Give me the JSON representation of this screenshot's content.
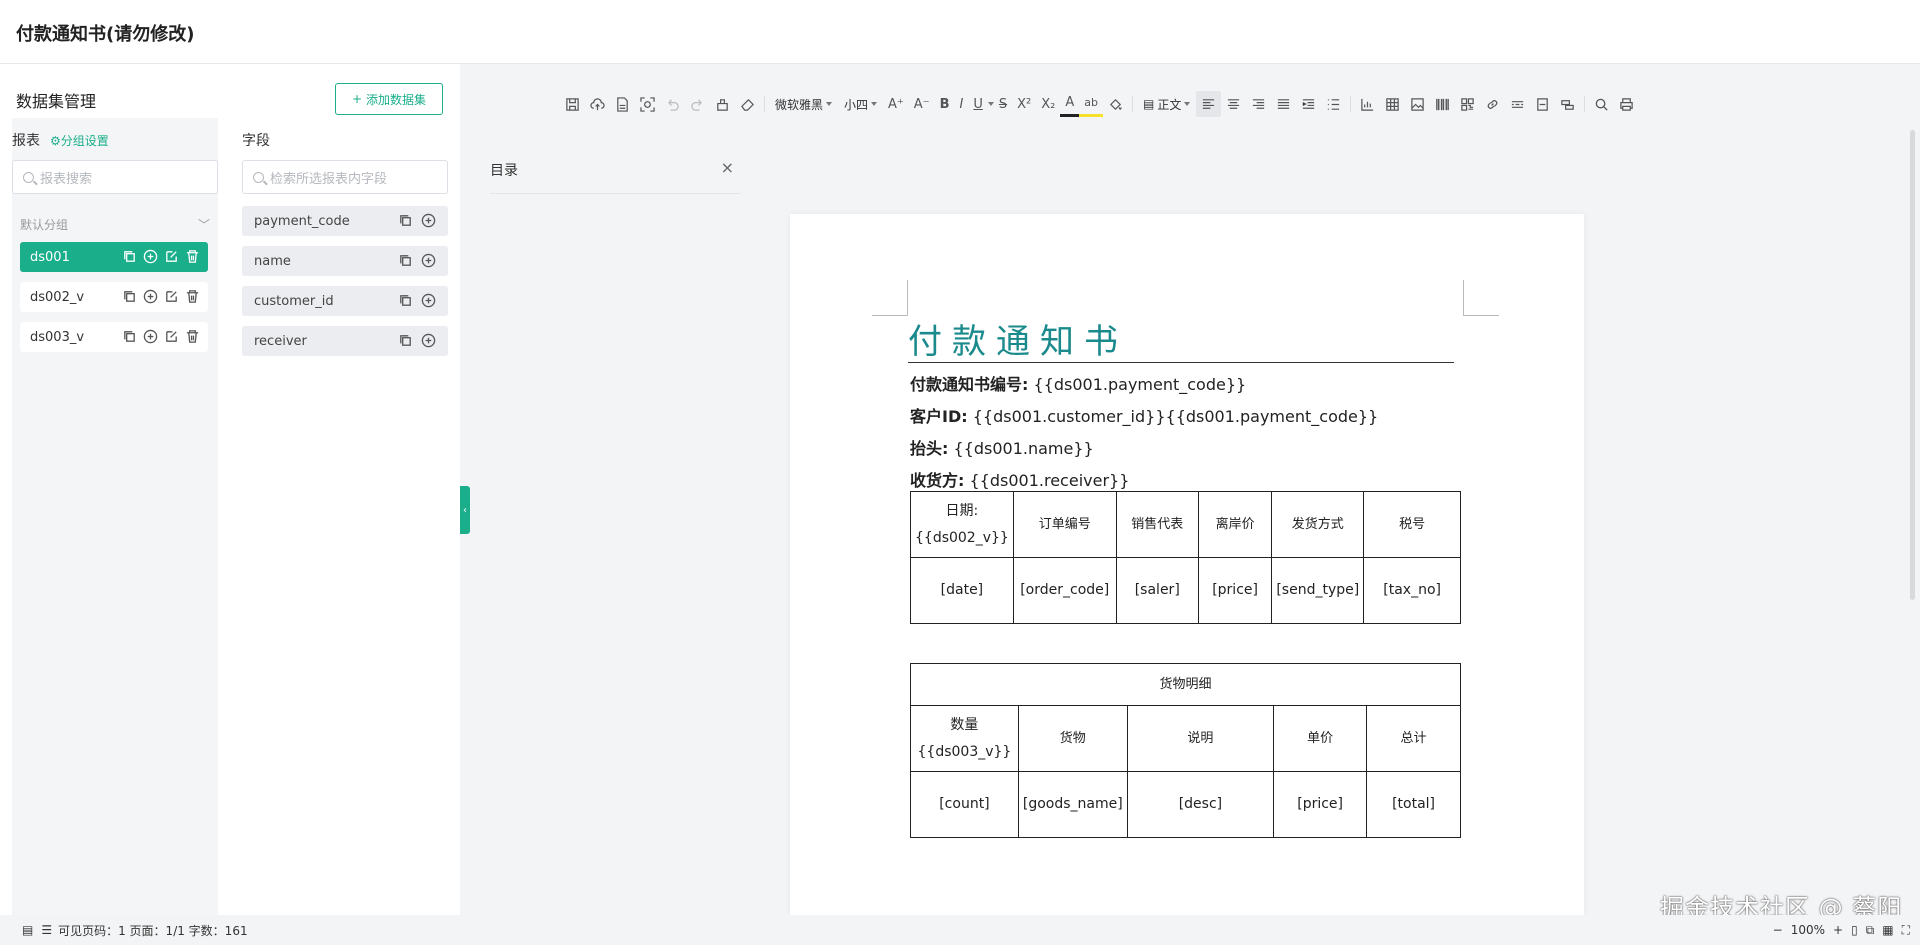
{
  "app": {
    "title": "付款通知书(请勿修改)"
  },
  "left_panel": {
    "title": "数据集管理",
    "add_button": "添加数据集",
    "reports_label": "报表",
    "group_settings": "分组设置",
    "report_search_placeholder": "报表搜索",
    "group_name": "默认分组",
    "datasets": [
      {
        "name": "ds001",
        "active": true
      },
      {
        "name": "ds002_v",
        "active": false
      },
      {
        "name": "ds003_v",
        "active": false
      }
    ],
    "fields_label": "字段",
    "field_search_placeholder": "检索所选报表内字段",
    "fields": [
      "payment_code",
      "name",
      "customer_id",
      "receiver"
    ]
  },
  "toolbar": {
    "font_family": "微软雅黑",
    "font_size": "小四",
    "paragraph_style": "正文",
    "icons": [
      "save-icon",
      "upload-icon",
      "export-pdf-icon",
      "preview-icon",
      "undo-icon",
      "redo-icon",
      "format-painter-icon",
      "eraser-icon"
    ]
  },
  "toc": {
    "title": "目录",
    "close": "×"
  },
  "document": {
    "title": "付款通知书",
    "lines": [
      {
        "label": "付款通知书编号:",
        "value": "{{ds001.payment_code}}"
      },
      {
        "label": "客户ID:",
        "value": "{{ds001.customer_id}}{{ds001.payment_code}}"
      },
      {
        "label": "抬头:",
        "value": "{{ds001.name}}"
      },
      {
        "label": "收货方:",
        "value": "{{ds001.receiver}}"
      }
    ],
    "table1": {
      "headers": [
        "日期:{{ds002_v}}",
        "订单编号",
        "销售代表",
        "离岸价",
        "发货方式",
        "税号"
      ],
      "row": [
        "[date]",
        "[order_code]",
        "[saler]",
        "[price]",
        "[send_type]",
        "[tax_no]"
      ]
    },
    "table2": {
      "caption": "货物明细",
      "headers": [
        "数量{{ds003_v}}",
        "货物",
        "说明",
        "单价",
        "总计"
      ],
      "row": [
        "[count]",
        "[goods_name]",
        "[desc]",
        "[price]",
        "[total]"
      ]
    }
  },
  "status": {
    "text": "可见页码：1  页面：1/1  字数：161",
    "zoom": "100%"
  },
  "watermark": "掘金技术社区 @ 蔡阳"
}
